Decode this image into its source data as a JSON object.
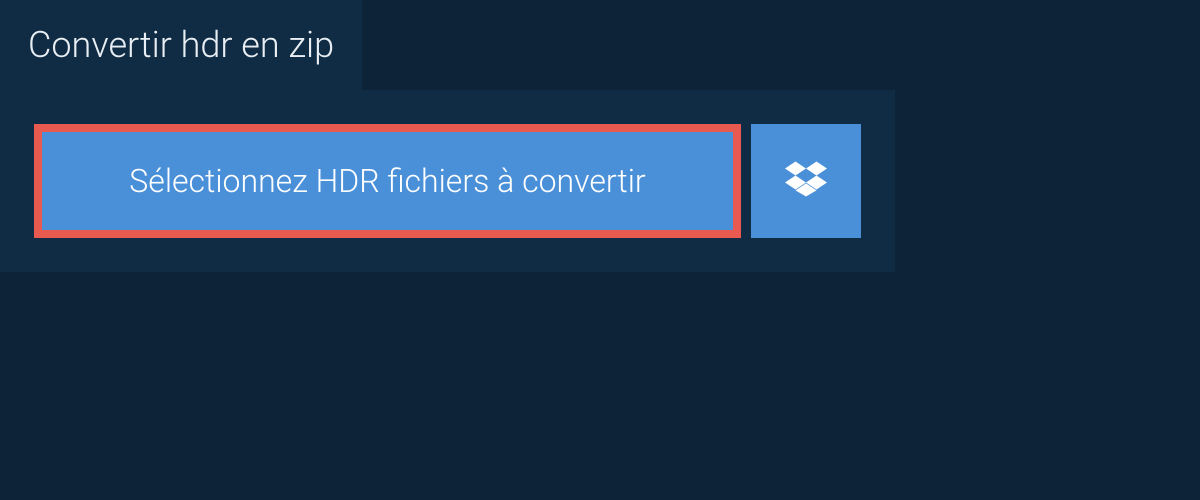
{
  "title": "Convertir hdr en zip",
  "actions": {
    "select_label": "Sélectionnez HDR fichiers à convertir"
  },
  "colors": {
    "background": "#0d2438",
    "panel": "#102c44",
    "button": "#4a90d9",
    "highlight_border": "#e85a4f",
    "text_light": "#ffffff"
  }
}
